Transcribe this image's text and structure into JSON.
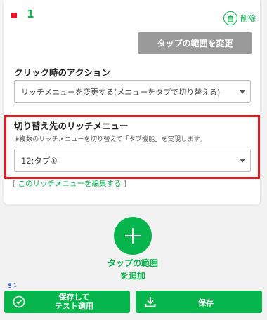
{
  "area": {
    "number": "1",
    "marker_color": "#e8132a",
    "delete_label": "削除",
    "delete_icon": "trash-icon",
    "change_range_label": "タップの範囲を変更"
  },
  "click_action": {
    "label": "クリック時のアクション",
    "selected": "リッチメニューを変更する(メニューをタブで切り替える)"
  },
  "switch_menu": {
    "label": "切り替え先のリッチメニュー",
    "hint": "※複数のリッチメニューを切り替えて「タブ機能」を実現します。",
    "selected": "12:タブ①",
    "edit_open": "[",
    "edit_link": "このリッチメニューを編集する",
    "edit_close": "]"
  },
  "add_area": {
    "label": "タップの範囲\nを追加",
    "icon": "plus-icon"
  },
  "footer": {
    "user_count": "1",
    "save_test_label": "保存して\nテスト適用",
    "save_label": "保存",
    "save_test_icon": "check-circle-icon",
    "save_icon": "download-icon"
  },
  "colors": {
    "accent": "#06b54c",
    "highlight": "#e01b24",
    "disabled_button": "#9a9a9a"
  }
}
